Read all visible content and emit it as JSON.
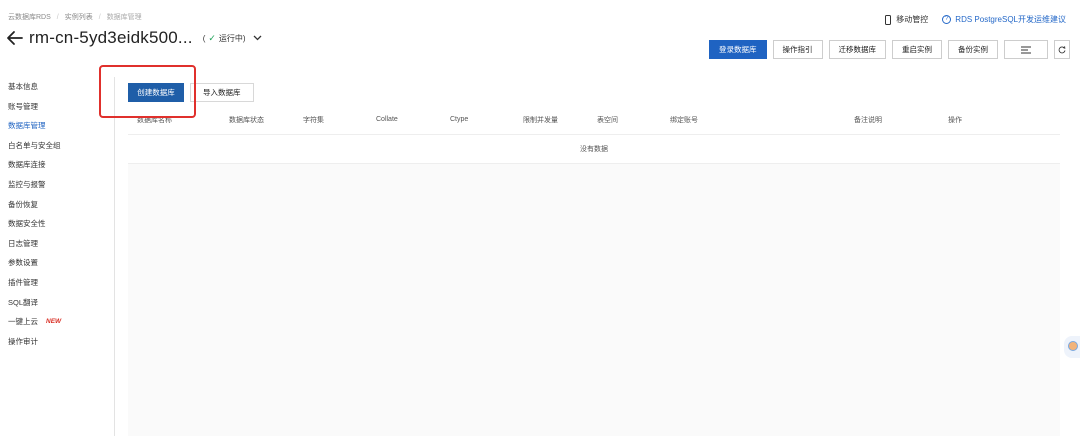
{
  "breadcrumb": [
    "云数据库RDS",
    "实例列表",
    "数据库管理"
  ],
  "topright": {
    "mobile_label": "移动管控",
    "advice_label": "RDS PostgreSQL开发运维建议"
  },
  "instance": {
    "title": "rm-cn-5yd3eidk500...",
    "status_open": "(",
    "status_label": "运行中",
    "status_close": ")"
  },
  "actions": {
    "login": "登录数据库",
    "guide": "操作指引",
    "migrate": "迁移数据库",
    "restart": "重启实例",
    "backup": "备份实例"
  },
  "sidebar": {
    "items": [
      {
        "label": "基本信息"
      },
      {
        "label": "账号管理"
      },
      {
        "label": "数据库管理"
      },
      {
        "label": "白名单与安全组"
      },
      {
        "label": "数据库连接"
      },
      {
        "label": "监控与报警"
      },
      {
        "label": "备份恢复"
      },
      {
        "label": "数据安全性"
      },
      {
        "label": "日志管理"
      },
      {
        "label": "参数设置"
      },
      {
        "label": "插件管理"
      },
      {
        "label": "SQL翻译"
      },
      {
        "label": "一键上云",
        "badge": "NEW"
      },
      {
        "label": "操作审计"
      }
    ]
  },
  "tabs": {
    "create": "创建数据库",
    "import": "导入数据库"
  },
  "table": {
    "headers": [
      "数据库名称",
      "数据库状态",
      "字符集",
      "Collate",
      "Ctype",
      "限制并发量",
      "表空间",
      "绑定账号",
      "备注说明",
      "操作"
    ],
    "empty_text": "没有数据"
  },
  "colors": {
    "primary": "#1f63c2",
    "highlight": "#e0302c",
    "running": "#20a35a",
    "new_badge": "#d93026"
  }
}
